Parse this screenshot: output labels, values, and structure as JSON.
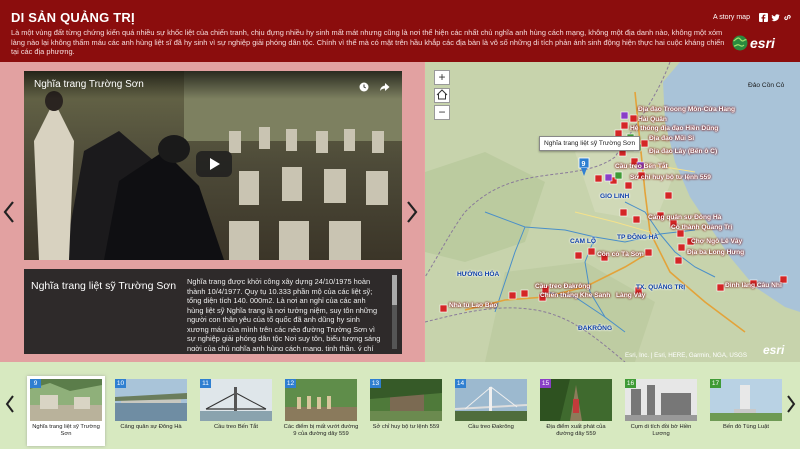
{
  "header": {
    "title": "DI SẢN QUẢNG TRỊ",
    "description": "Là một vùng đất từng chứng kiến quá nhiều sự khốc liệt của chiến tranh, chịu đựng nhiều hy sinh mất mát nhưng cũng là nơi thể hiện các nhất chủ nghĩa anh hùng cách mạng, không một địa danh nào, không một xóm làng nào lại không thấm máu các anh hùng liệt sĩ đã hy sinh vì sự nghiệp giải phóng dân tộc. Chính vì thế mà có mặt trên hầu khắp các địa bàn là vô số những di tích phản ánh sinh động hiện thực hai cuộc kháng chiến tại các địa phương.",
    "story_map_label": "A story map",
    "social": [
      "facebook-icon",
      "twitter-icon",
      "link-icon"
    ],
    "logo_text": "esri"
  },
  "video": {
    "title": "Nghĩa trang Trường Sơn"
  },
  "caption": {
    "title": "Nghĩa trang liệt sỹ Trường Sơn",
    "text": "Nghĩa trang được khởi công xây dựng 24/10/1975 hoàn thành 10/4/1977. Quy tụ 10.333 phần mộ của các liệt sỹ; tổng diện tích 140. 000m2. Là nơi an nghỉ của các anh hùng liệt sỹ Nghĩa trang là nơi tưởng niệm, suy tôn những người con thân yêu của tổ quốc đã anh dũng hy sinh xương máu của mình trên các nẻo đường Trường Sơn vì sự nghiệp giải phóng dân tộc Nơi suy tôn, biểu tượng sáng ngời của chủ nghĩa anh hùng cách mạng, tinh thần, ý chí đấu tranh"
  },
  "map": {
    "tooltip": "Nghĩa trang liệt sỹ Trường Sơn",
    "attribution": "Esri, Inc. | Esri, HERE, Garmin, NGA, USGS",
    "logo": "esri",
    "labels": [
      "Đảo Cồn Cỏ",
      "Địa đạo Troong Môn-Cửa Hang",
      "Hải Quân",
      "Hệ thống địa đạo Hiền Dũng",
      "Địa đạo Mũi Si",
      "Địa đạo Lây (Bến ô C)",
      "Cầu treo Bến Tắt",
      "Sở chỉ huy bộ tư lệnh 559",
      "Cảng quân sự Đông Hà",
      "Cổ thành Quảng Trị",
      "Chợ Ngô Lê Vây",
      "Địa ba Long Hưng",
      "Cầu treo Đakrông",
      "Chiến thắng Khe Sanh",
      "Làng Vây",
      "Nhà tù Lao Bảo",
      "Đình làng Câu Nhĩ",
      "Cồn cỏ Tà Sơn"
    ],
    "districts": [
      "GIO LINH",
      "CAM LỘ",
      "TP ĐÔNG HÀ",
      "HƯỚNG HÓA",
      "TX. QUẢNG TRỊ",
      "ĐAKRÔNG"
    ],
    "zoom_in": "+",
    "zoom_out": "−"
  },
  "colors": {
    "header_bg": "#8b0d0d",
    "panel_bg": "#e2a1a1",
    "strip_bg": "#d7e9c0",
    "marker_red": "#d42626"
  },
  "thumbnails": [
    {
      "num": "9",
      "label": "Nghĩa trang liệt sỹ Trường Sơn",
      "color": "#2f7fd1"
    },
    {
      "num": "10",
      "label": "Cảng quân sự Đông Hà",
      "color": "#2f7fd1"
    },
    {
      "num": "11",
      "label": "Cầu treo Bến Tắt",
      "color": "#2f7fd1"
    },
    {
      "num": "12",
      "label": "Các điểm bị mất vướt đường 9 của đường dây 559",
      "color": "#2f7fd1"
    },
    {
      "num": "13",
      "label": "Sở chỉ huy bộ tư lệnh 559",
      "color": "#2f7fd1"
    },
    {
      "num": "14",
      "label": "Cầu treo Đakrông",
      "color": "#2f7fd1"
    },
    {
      "num": "15",
      "label": "Địa điểm xuất phát của đường dây 559",
      "color": "#8a3fc7"
    },
    {
      "num": "16",
      "label": "Cụm di tích đồi bờ Hiền Lương",
      "color": "#3f9b36"
    },
    {
      "num": "17",
      "label": "Bến đò Tùng Luật",
      "color": "#3f9b36"
    }
  ]
}
